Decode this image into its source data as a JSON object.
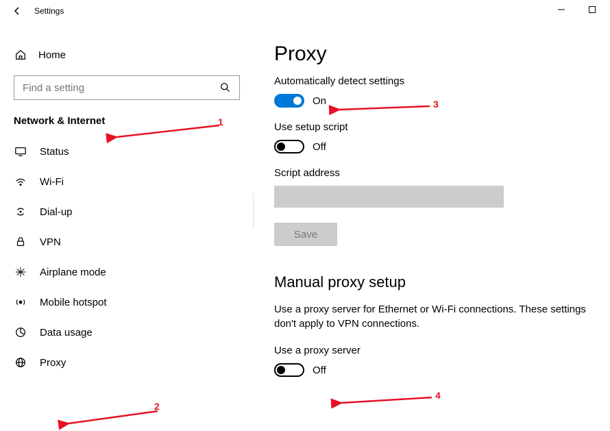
{
  "window": {
    "title": "Settings"
  },
  "sidebar": {
    "home": "Home",
    "search_placeholder": "Find a setting",
    "category": "Network & Internet",
    "items": [
      {
        "label": "Status"
      },
      {
        "label": "Wi-Fi"
      },
      {
        "label": "Dial-up"
      },
      {
        "label": "VPN"
      },
      {
        "label": "Airplane mode"
      },
      {
        "label": "Mobile hotspot"
      },
      {
        "label": "Data usage"
      },
      {
        "label": "Proxy"
      }
    ]
  },
  "main": {
    "title": "Proxy",
    "auto_detect_label": "Automatically detect settings",
    "auto_detect_state": "On",
    "setup_script_label": "Use setup script",
    "setup_script_state": "Off",
    "script_address_label": "Script address",
    "script_address_value": "",
    "save_label": "Save",
    "manual_section": "Manual proxy setup",
    "manual_desc": "Use a proxy server for Ethernet or Wi-Fi connections. These settings don't apply to VPN connections.",
    "use_proxy_label": "Use a proxy server",
    "use_proxy_state": "Off"
  },
  "annotations": {
    "1": "1",
    "2": "2",
    "3": "3",
    "4": "4"
  }
}
